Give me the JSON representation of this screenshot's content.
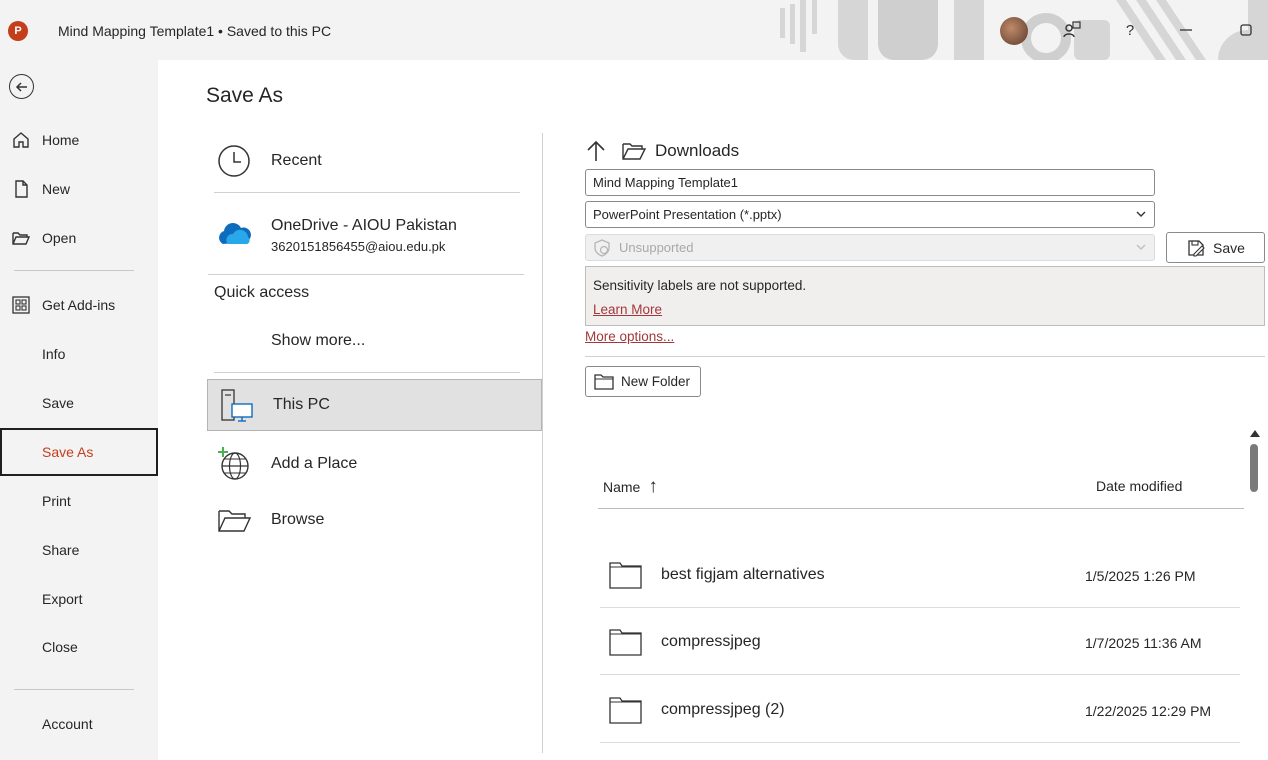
{
  "window": {
    "app_logo_letter": "P",
    "title": "Mind Mapping Template1 • Saved to this PC"
  },
  "titlebar_icons": [
    "coauthor-icon",
    "help-icon",
    "minimize-icon",
    "maximize-icon"
  ],
  "help_glyph": "?",
  "nav": {
    "items": [
      {
        "id": "home",
        "label": "Home",
        "icon": "home-icon"
      },
      {
        "id": "new",
        "label": "New",
        "icon": "new-document-icon"
      },
      {
        "id": "open",
        "label": "Open",
        "icon": "open-folder-icon"
      },
      {
        "id": "get-add-ins",
        "label": "Get Add-ins",
        "icon": "add-ins-icon"
      },
      {
        "id": "info",
        "label": "Info"
      },
      {
        "id": "save",
        "label": "Save"
      },
      {
        "id": "save-as",
        "label": "Save As",
        "selected": true
      },
      {
        "id": "print",
        "label": "Print"
      },
      {
        "id": "share",
        "label": "Share"
      },
      {
        "id": "export",
        "label": "Export"
      },
      {
        "id": "close",
        "label": "Close"
      },
      {
        "id": "account",
        "label": "Account"
      }
    ]
  },
  "page_title": "Save As",
  "places": {
    "recent": "Recent",
    "onedrive_name": "OneDrive - AIOU Pakistan",
    "onedrive_email": "3620151856455@aiou.edu.pk",
    "quick_access": "Quick access",
    "show_more": "Show more...",
    "this_pc": "This PC",
    "add_place": "Add a Place",
    "browse": "Browse"
  },
  "save_panel": {
    "current_folder": "Downloads",
    "file_name": "Mind Mapping Template1",
    "file_type": "PowerPoint Presentation (*.pptx)",
    "sensitivity_value": "Unsupported",
    "save_label": "Save",
    "sensitivity_message": "Sensitivity labels are not supported.",
    "learn_more": "Learn More",
    "more_options": "More options...",
    "new_folder": "New Folder"
  },
  "file_list": {
    "columns": {
      "name": "Name",
      "date": "Date modified"
    },
    "sort_indicator": "↑",
    "rows": [
      {
        "name": "best figjam alternatives",
        "date": "1/5/2025 1:26 PM"
      },
      {
        "name": "compressjpeg",
        "date": "1/7/2025 11:36 AM"
      },
      {
        "name": "compressjpeg (2)",
        "date": "1/22/2025 12:29 PM"
      }
    ]
  },
  "colors": {
    "accent": "#c43e1c",
    "link": "#a4373a",
    "onedrive": "#0f6cbd"
  }
}
